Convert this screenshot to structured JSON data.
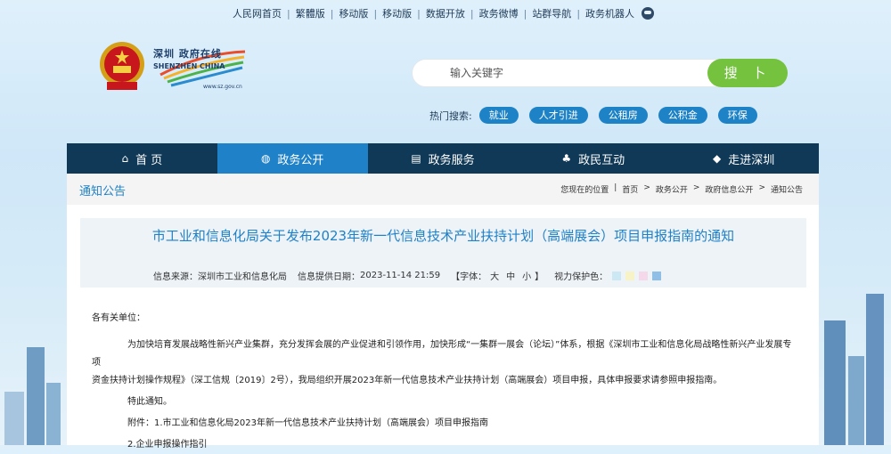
{
  "top_links": [
    "人民网首页",
    "繁體版",
    "移动版",
    "移动版",
    "数据开放",
    "政务微博",
    "站群导航",
    "政务机器人"
  ],
  "logo": {
    "cn": "深圳 政府在线",
    "en": "SHENZHEN CHINA",
    "url": "www.sz.gov.cn"
  },
  "search": {
    "placeholder": "输入关键字",
    "button": "搜 卜"
  },
  "hot": {
    "label": "热门搜索:",
    "chips": [
      "就业",
      "人才引进",
      "公租房",
      "公积金",
      "环保"
    ]
  },
  "nav": [
    {
      "label": "首 页",
      "icon": "home-icon",
      "glyph": "⌂"
    },
    {
      "label": "政务公开",
      "icon": "gov-icon",
      "glyph": "◍"
    },
    {
      "label": "政务服务",
      "icon": "service-icon",
      "glyph": "▤"
    },
    {
      "label": "政民互动",
      "icon": "people-icon",
      "glyph": "♣"
    },
    {
      "label": "走进深圳",
      "icon": "shenzhen-icon",
      "glyph": "◆"
    }
  ],
  "section": "通知公告",
  "breadcrumb": {
    "prefix": "您现在的位置",
    "items": [
      "首页",
      "政务公开",
      "政府信息公开",
      "通知公告"
    ]
  },
  "article": {
    "title": "市工业和信息化局关于发布2023年新一代信息技术产业扶持计划（高端展会）项目申报指南的通知",
    "source_label": "信息来源：",
    "source": "深圳市工业和信息化局",
    "date_label": "信息提供日期：",
    "date": "2023-11-14 21:59",
    "font_label": "【字体：",
    "font_sizes": [
      "大",
      "中",
      "小"
    ],
    "font_end": "】",
    "vision_label": "视力保护色：",
    "vision_colors": [
      "#cce8f5",
      "#f7f3c6",
      "#f5d8ea",
      "#8fbfe6"
    ],
    "greeting": "各有关单位：",
    "para1": "为加快培育发展战略性新兴产业集群，充分发挥会展的产业促进和引领作用，加快形成“一集群一展会（论坛）”体系，根据《深圳市工业和信息化局战略性新兴产业发展专项",
    "para2": "资金扶持计划操作规程》（深工信规〔2019〕2号），我局组织开展2023年新一代信息技术产业扶持计划（高端展会）项目申报，具体申报要求请参照申报指南。",
    "notice": "特此通知。",
    "attach1": "附件：1.市工业和信息化局2023年新一代信息技术产业扶持计划（高端展会）项目申报指南",
    "attach2": "2.企业申报操作指引"
  }
}
